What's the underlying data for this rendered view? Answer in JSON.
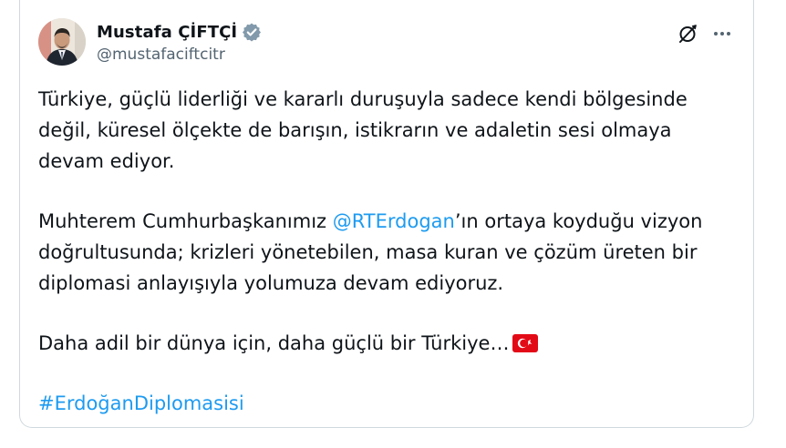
{
  "author": {
    "display_name": "Mustafa ÇİFTÇİ",
    "handle": "@mustafaciftcitr",
    "verified_icon": "verified-badge-icon",
    "avatar_icon": "avatar-image"
  },
  "actions": {
    "grok_icon": "grok-icon",
    "more_icon": "more-options-icon"
  },
  "post": {
    "p1": "Türkiye, güçlü liderliği ve kararlı duruşuyla sadece kendi bölgesinde değil, küresel ölçekte de barışın, istikrarın ve adaletin sesi olmaya devam ediyor.",
    "p2_before": "Muhterem Cumhurbaşkanımız ",
    "p2_mention": "@RTErdogan",
    "p2_after": "’ın ortaya koyduğu vizyon doğrultusunda; krizleri yönetebilen, masa kuran ve çözüm üreten bir diplomasi anlayışıyla yolumuza devam ediyoruz.",
    "p3": "Daha adil bir dünya için, daha güçlü bir Türkiye…",
    "p3_emoji": "turkey-flag",
    "hashtag": "#ErdoğanDiplomasisi"
  },
  "colors": {
    "link": "#1d9bf0",
    "text": "#0f1419",
    "secondary": "#536471",
    "verified": "#829aab",
    "flag_red": "#e30a17"
  }
}
